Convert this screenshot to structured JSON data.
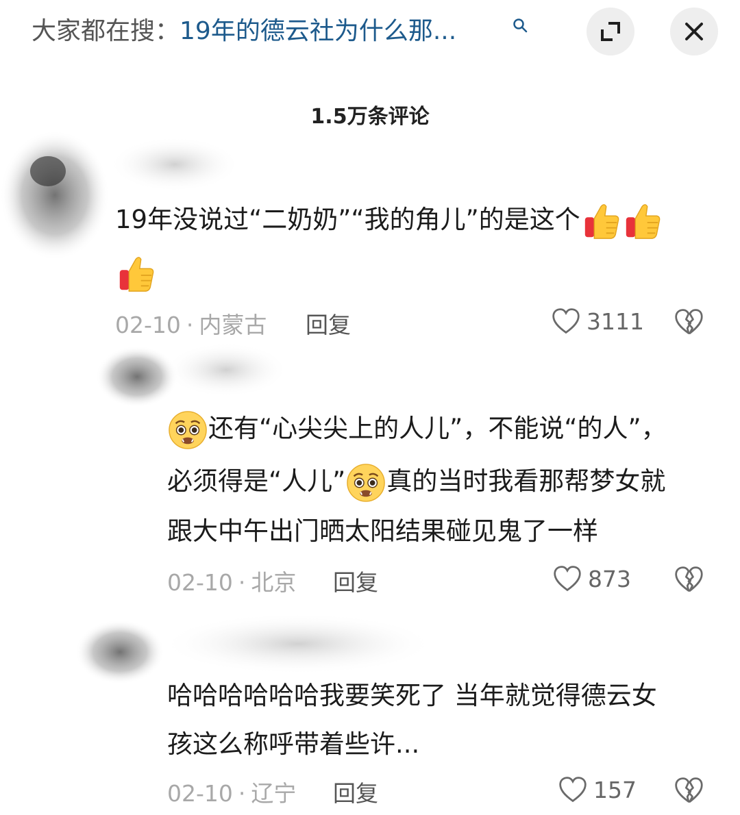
{
  "search": {
    "prefix": "大家都在搜：",
    "query": "19年的德云社为什么那..."
  },
  "header": {
    "comment_count": "1.5万条评论"
  },
  "comments": [
    {
      "line1": "19年没说过“二奶奶”“我的角儿”的是这个",
      "date": "02-10",
      "location": "内蒙古",
      "reply_label": "回复",
      "likes": "3111"
    },
    {
      "line1": "还有“心尖尖上的人儿”，不能说“的人”，",
      "line2a": "必须得是“人儿”",
      "line2b": "真的当时我看那帮梦女就",
      "line3": "跟大中午出门晒太阳结果碰见鬼了一样",
      "date": "02-10",
      "location": "北京",
      "reply_label": "回复",
      "likes": "873"
    },
    {
      "line1": "哈哈哈哈哈哈我要笑死了 当年就觉得德云女",
      "line2": "孩这么称呼带着些许...",
      "date": "02-10",
      "location": "辽宁",
      "reply_label": "回复",
      "likes": "157"
    }
  ],
  "colors": {
    "query_link": "#1d5a8c",
    "meta_gray": "#a8a8a8",
    "button_bg": "#eeeeee"
  },
  "icons": [
    "search-icon",
    "expand-icon",
    "close-icon",
    "thumbs-up-emoji",
    "pleading-face-emoji",
    "heart-icon",
    "broken-heart-icon"
  ]
}
